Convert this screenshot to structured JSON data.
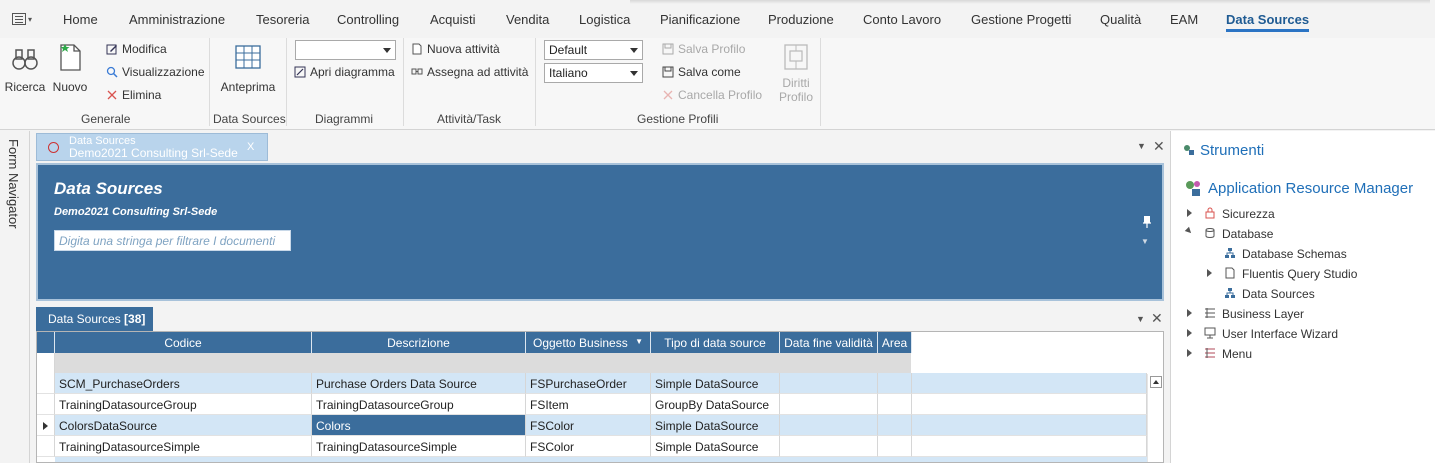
{
  "menu": {
    "items": [
      "Home",
      "Amministrazione",
      "Tesoreria",
      "Controlling",
      "Acquisti",
      "Vendita",
      "Logistica",
      "Pianificazione",
      "Produzione",
      "Conto Lavoro",
      "Gestione Progetti",
      "Qualità",
      "EAM",
      "Data Sources"
    ],
    "active": "Data Sources"
  },
  "ribbon": {
    "generale": {
      "label": "Generale",
      "ricerca": "Ricerca",
      "nuovo": "Nuovo",
      "modifica": "Modifica",
      "visualizzazione": "Visualizzazione",
      "elimina": "Elimina"
    },
    "datasources": {
      "label": "Data Sources",
      "anteprima": "Anteprima"
    },
    "diagrammi": {
      "label": "Diagrammi",
      "combo_value": "",
      "apri": "Apri diagramma"
    },
    "attivita": {
      "label": "Attività/Task",
      "nuova": "Nuova attività",
      "assegna": "Assegna ad attività"
    },
    "profili": {
      "label": "Gestione Profili",
      "combo_profile": "Default",
      "combo_language": "Italiano",
      "salva_profilo": "Salva Profilo",
      "salva_come": "Salva come",
      "cancella_profilo": "Cancella Profilo",
      "diritti_1": "Diritti",
      "diritti_2": "Profilo"
    }
  },
  "form_navigator": "Form Navigator",
  "doc_tab": {
    "line1": "Data Sources",
    "line2": "Demo2021 Consulting Srl-Sede",
    "close": "X"
  },
  "header": {
    "title": "Data Sources",
    "subtitle": "Demo2021 Consulting Srl-Sede",
    "filter_placeholder": "Digita una stringa per filtrare I documenti"
  },
  "grid_tab": {
    "label": "Data Sources",
    "count": "[38]"
  },
  "grid": {
    "columns": [
      "Codice",
      "Descrizione",
      "Oggetto Business",
      "Tipo di data source",
      "Data fine validità",
      "Area"
    ],
    "rows": [
      [
        "SCM_PurchaseOrders",
        "Purchase Orders Data Source",
        "FSPurchaseOrder",
        "Simple DataSource",
        "",
        ""
      ],
      [
        "TrainingDatasourceGroup",
        "TrainingDatasourceGroup",
        "FSItem",
        "GroupBy DataSource",
        "",
        ""
      ],
      [
        "ColorsDataSource",
        "Colors",
        "FSColor",
        "Simple DataSource",
        "",
        ""
      ],
      [
        "TrainingDatasourceSimple",
        "TrainingDatasourceSimple",
        "FSColor",
        "Simple DataSource",
        "",
        ""
      ]
    ]
  },
  "right_panel": {
    "strumenti": "Strumenti",
    "arm": "Application Resource Manager",
    "tree": {
      "sicurezza": "Sicurezza",
      "database": "Database",
      "db_schemas": "Database Schemas",
      "query_studio": "Fluentis Query Studio",
      "data_sources": "Data Sources",
      "business_layer": "Business Layer",
      "ui_wizard": "User Interface Wizard",
      "menu": "Menu"
    }
  },
  "colors": {
    "accent": "#3b6d9c",
    "link": "#1f6fb8",
    "row_alt": "#d3e6f6"
  }
}
